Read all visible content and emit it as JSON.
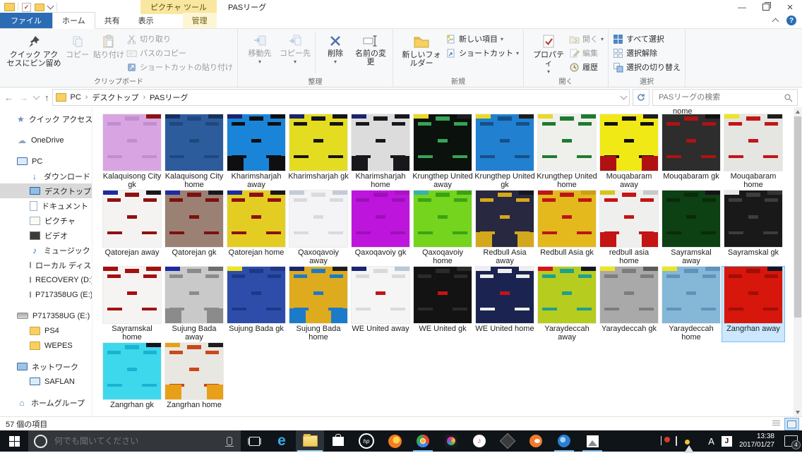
{
  "window": {
    "title": "PASリーグ",
    "context_title": "ピクチャ ツール"
  },
  "ribbon": {
    "tabs": {
      "file": "ファイル",
      "home": "ホーム",
      "share": "共有",
      "view": "表示",
      "manage": "管理"
    },
    "pin": "クイック アクセスにピン留め",
    "copy": "コピー",
    "paste": "貼り付け",
    "cut": "切り取り",
    "copy_path": "パスのコピー",
    "paste_shortcut": "ショートカットの貼り付け",
    "group_clipboard": "クリップボード",
    "move_to": "移動先",
    "copy_to": "コピー先",
    "delete": "削除",
    "rename": "名前の変更",
    "group_organize": "整理",
    "new_folder": "新しいフォルダー",
    "new_item": "新しい項目",
    "shortcut": "ショートカット",
    "group_new": "新規",
    "properties": "プロパティ",
    "open": "開く",
    "edit": "編集",
    "history": "履歴",
    "group_open": "開く",
    "select_all": "すべて選択",
    "select_none": "選択解除",
    "invert_selection": "選択の切り替え",
    "group_select": "選択"
  },
  "address": {
    "crumbs": [
      "PC",
      "デスクトップ",
      "PASリーグ"
    ],
    "search_placeholder": "PASリーグの検索"
  },
  "sidebar": {
    "items": [
      {
        "icon": "star",
        "label": "クイック アクセス",
        "indent": 0
      },
      {
        "icon": "cloud",
        "label": "OneDrive",
        "indent": 0,
        "gap": true
      },
      {
        "icon": "monitor",
        "label": "PC",
        "indent": 0,
        "gap": true
      },
      {
        "icon": "download",
        "label": "ダウンロード",
        "indent": 1
      },
      {
        "icon": "desktop",
        "label": "デスクトップ",
        "indent": 1,
        "selected": true
      },
      {
        "icon": "document",
        "label": "ドキュメント",
        "indent": 1
      },
      {
        "icon": "picture",
        "label": "ピクチャ",
        "indent": 1
      },
      {
        "icon": "video",
        "label": "ビデオ",
        "indent": 1
      },
      {
        "icon": "music",
        "label": "ミュージック",
        "indent": 1
      },
      {
        "icon": "disk",
        "label": "ローカル ディスク (C:)",
        "indent": 1
      },
      {
        "icon": "disk",
        "label": "RECOVERY (D:)",
        "indent": 1
      },
      {
        "icon": "disk",
        "label": "P717358UG (E:)",
        "indent": 1
      },
      {
        "icon": "disk",
        "label": "P717358UG (E:)",
        "indent": 0,
        "gap": true
      },
      {
        "icon": "folder",
        "label": "PS4",
        "indent": 1
      },
      {
        "icon": "folder",
        "label": "WEPES",
        "indent": 1
      },
      {
        "icon": "network",
        "label": "ネットワーク",
        "indent": 0,
        "gap": true
      },
      {
        "icon": "monitor",
        "label": "SAFLAN",
        "indent": 1
      },
      {
        "icon": "homegroup",
        "label": "ホームグループ",
        "indent": 0,
        "gap": true
      }
    ]
  },
  "files": {
    "partial_label_top": "nome",
    "items": [
      {
        "name": "Kalaquisong City gk",
        "base": "#d8a5e2",
        "detail": "#c08fd0",
        "tr": "#8e1212"
      },
      {
        "name": "Kalaquisong City home",
        "base": "#2d5c9c",
        "detail": "#1f4880",
        "tl": "#16305e",
        "tr": "#16305e"
      },
      {
        "name": "Kharimsharjah away",
        "base": "#1a85d8",
        "detail": "#0f0f12",
        "tl": "#1a2470",
        "tr": "#0f0f12",
        "corner": "#0f0f12"
      },
      {
        "name": "Kharimsharjah gk",
        "base": "#e4dc20",
        "detail": "#14141a",
        "tl": "#1a2470",
        "tr": "#14141a"
      },
      {
        "name": "Kharimsharjah home",
        "base": "#dcdcdc",
        "detail": "#17171c",
        "tl": "#1a2470",
        "tr": "#17171c",
        "corner": "#17171c"
      },
      {
        "name": "Krungthep United away",
        "base": "#0b110c",
        "detail": "#35a455",
        "tl": "#ecd922",
        "tr": "#1d1d1d"
      },
      {
        "name": "Krungthep United gk",
        "base": "#2180cf",
        "detail": "#155089",
        "tl": "#ecd922",
        "tr": "#1d1d1d"
      },
      {
        "name": "Krungthep United home",
        "base": "#eff0eb",
        "detail": "#1e7b31",
        "tl": "#ecd922",
        "tr": "#1e7b31"
      },
      {
        "name": "Mouqabaram away",
        "base": "#f1e915",
        "detail": "#111111",
        "tr": "#1d1d1d",
        "corner": "#b01212"
      },
      {
        "name": "Mouqabaram gk",
        "base": "#2d2d2d",
        "detail": "#b01212",
        "tr": "#111111"
      },
      {
        "name": "Mouqabaram home",
        "base": "#e5e5e1",
        "detail": "#c21616",
        "tl": "#f0e31f",
        "tr": "#1d1d1d"
      },
      {
        "name": "Qatorejan away",
        "base": "#f4f3f1",
        "detail": "#8e1111",
        "tl": "#1c2ba2",
        "tr": "#17171c"
      },
      {
        "name": "Qatorejan gk",
        "base": "#9a8173",
        "detail": "#7c1010",
        "tl": "#1c2ba2",
        "tr": "#17171c"
      },
      {
        "name": "Qatorejan home",
        "base": "#e4cd22",
        "detail": "#8e1111",
        "tl": "#1c2ba2",
        "tr": "#17171c"
      },
      {
        "name": "Qaxoqavoiy away",
        "base": "#f4f4f6",
        "detail": "#d8dade",
        "tl": "#c3cbd8",
        "tr": "#c3cbd8"
      },
      {
        "name": "Qaxoqavoiy gk",
        "base": "#be15dd",
        "detail": "#9b10b8",
        "tr": "#a912c4"
      },
      {
        "name": "Qaxoqavoiy home",
        "base": "#74d41e",
        "detail": "#3ba312",
        "tl": "#35b4ad",
        "tr": "#3ba312"
      },
      {
        "name": "Redbull Asia away",
        "base": "#282840",
        "detail": "#d4a81d",
        "tr": "#15151f",
        "corner": "#d4a81d"
      },
      {
        "name": "Redbull Asia gk",
        "base": "#e3b91e",
        "detail": "#bc1616",
        "tl": "#bc1616",
        "tr": "#c9a115"
      },
      {
        "name": "redbull asia home",
        "base": "#efefed",
        "detail": "#c41414",
        "tl": "#d8c418",
        "tr": "#c8c8c8",
        "corner": "#c41414"
      },
      {
        "name": "Sayramskal away",
        "base": "#0d4012",
        "detail": "#082c0c",
        "tr": "#14141a"
      },
      {
        "name": "Sayramskal gk",
        "base": "#191919",
        "detail": "#3d3d3d",
        "tl": "#e8e8e8",
        "tr": "#333333"
      },
      {
        "name": "Sayramskal home",
        "base": "#f5f4f2",
        "detail": "#a60f0f",
        "tl": "#a60f0f",
        "tr": "#a60f0f"
      },
      {
        "name": "Sujung Bada away",
        "base": "#c9c9c9",
        "detail": "#8b8b8b",
        "tl": "#1b2aa0",
        "tr": "#6e6e6e",
        "corner": "#8b8b8b"
      },
      {
        "name": "Sujung Bada gk",
        "base": "#2e4dab",
        "detail": "#1e3787",
        "tl": "#efe41d",
        "tr": "#1e3787"
      },
      {
        "name": "Sujung Bada home",
        "base": "#deaa1e",
        "detail": "#1b7bc9",
        "tl": "#1a2470",
        "tr": "#1d1d1d",
        "corner": "#1b7bc9"
      },
      {
        "name": "WE United away",
        "base": "#f5f5f5",
        "detail": "#dadada",
        "mid": "#c41414",
        "tl": "#1a2470",
        "tr": "#b8c8d8"
      },
      {
        "name": "WE United gk",
        "base": "#131313",
        "detail": "#2b2b2b",
        "mid": "#c41414",
        "tr": "#2b2b2b"
      },
      {
        "name": "WE United home",
        "base": "#1b2450",
        "detail": "#eeeeee",
        "mid": "#c41414",
        "tl": "#eeeeee",
        "tr": "#eeeeee"
      },
      {
        "name": "Yaraydeccah away",
        "base": "#b6cc1f",
        "detail": "#1da08f",
        "tl": "#d81414",
        "tr": "#15151f"
      },
      {
        "name": "Yaraydeccah gk",
        "base": "#a9a9a9",
        "detail": "#7d7d7d",
        "tl": "#efe41d",
        "tr": "#5a5a5a"
      },
      {
        "name": "Yaraydeccah home",
        "base": "#85b7d7",
        "detail": "#5e94bb",
        "tl": "#efe41d",
        "tr": "#5e94bb"
      },
      {
        "name": "Zangrhan away",
        "base": "#d7160c",
        "detail": "#a30d06",
        "tr": "#15151f",
        "selected": true
      },
      {
        "name": "Zangrhan gk",
        "base": "#3ed8ed",
        "detail": "#17b4d2",
        "tr": "#15151f"
      },
      {
        "name": "Zangrhan home",
        "base": "#e9e7e1",
        "detail": "#c8491a",
        "tl": "#e8a018",
        "tr": "#1d1d1d",
        "corner": "#e8a018"
      }
    ]
  },
  "status_bar": {
    "items_count": "57 個の項目"
  },
  "taskbar": {
    "search_placeholder": "何でも聞いてください",
    "apps": [
      {
        "id": "edge"
      },
      {
        "id": "file-explorer",
        "active": true
      },
      {
        "id": "store"
      },
      {
        "id": "hp"
      },
      {
        "id": "firefox"
      },
      {
        "id": "chrome",
        "running": true
      },
      {
        "id": "photo-editor"
      },
      {
        "id": "itunes"
      },
      {
        "id": "inkscape"
      },
      {
        "id": "blender"
      },
      {
        "id": "app-blue",
        "running": true
      },
      {
        "id": "photos",
        "running": true
      }
    ],
    "tray": [
      "chevron-up",
      "security",
      "pen",
      "wifi",
      "volume",
      "ime-a",
      "ime-j"
    ],
    "clock": {
      "time": "13:38",
      "date": "2017/01/27"
    },
    "notification_count": "4"
  }
}
